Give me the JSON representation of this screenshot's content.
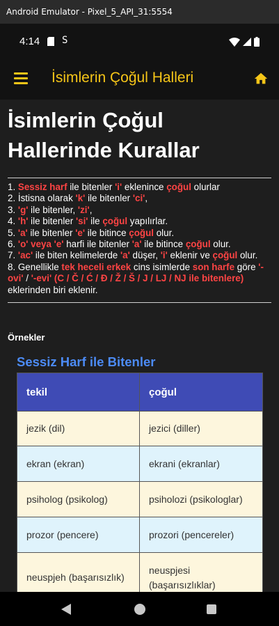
{
  "window": {
    "title": "Android Emulator - Pixel_5_API_31:5554"
  },
  "status": {
    "time": "4:14",
    "s_icon_glyph": "S",
    "icons": [
      "sd-card-icon",
      "sync-icon",
      "wifi-icon",
      "signal-icon",
      "battery-icon"
    ]
  },
  "appbar": {
    "title": "İsimlerin Çoğul Halleri",
    "menu_icon": "menu-icon",
    "home_icon": "home-icon",
    "accent": "#f5c518"
  },
  "page": {
    "title": "İsimlerin Çoğul Hallerinde Kurallar",
    "rules": [
      [
        {
          "t": "1. "
        },
        {
          "t": "Sessiz harf",
          "h": true
        },
        {
          "t": " ile bitenler "
        },
        {
          "t": "'i'",
          "h": true
        },
        {
          "t": " eklenince "
        },
        {
          "t": "çoğul",
          "h": true
        },
        {
          "t": " olurlar"
        }
      ],
      [
        {
          "t": "2. İstisna olarak "
        },
        {
          "t": "'k'",
          "h": true
        },
        {
          "t": " ile bitenler "
        },
        {
          "t": "'ci'",
          "h": true
        },
        {
          "t": ","
        }
      ],
      [
        {
          "t": "3. "
        },
        {
          "t": "'g'",
          "h": true
        },
        {
          "t": " ile bitenler, "
        },
        {
          "t": "'zi'",
          "h": true
        },
        {
          "t": ","
        }
      ],
      [
        {
          "t": "4. "
        },
        {
          "t": "'h'",
          "h": true
        },
        {
          "t": " ile bitenler "
        },
        {
          "t": "'si'",
          "h": true
        },
        {
          "t": " ile "
        },
        {
          "t": "çoğul",
          "h": true
        },
        {
          "t": " yapılırlar."
        }
      ],
      [
        {
          "t": "5. "
        },
        {
          "t": "'a'",
          "h": true
        },
        {
          "t": " ile bitenler "
        },
        {
          "t": "'e'",
          "h": true
        },
        {
          "t": " ile bitince "
        },
        {
          "t": "çoğul",
          "h": true
        },
        {
          "t": " olur."
        }
      ],
      [
        {
          "t": "6. "
        },
        {
          "t": "'o' veya 'e'",
          "h": true
        },
        {
          "t": " harfi ile bitenler "
        },
        {
          "t": "'a'",
          "h": true
        },
        {
          "t": " ile bitince "
        },
        {
          "t": "çoğul",
          "h": true
        },
        {
          "t": " olur."
        }
      ],
      [
        {
          "t": "7. "
        },
        {
          "t": "'ac'",
          "h": true
        },
        {
          "t": " ile biten kelimelerde "
        },
        {
          "t": "'a'",
          "h": true
        },
        {
          "t": " düşer, "
        },
        {
          "t": "'i'",
          "h": true
        },
        {
          "t": " eklenir ve "
        },
        {
          "t": "çoğul",
          "h": true
        },
        {
          "t": " olur."
        }
      ],
      [
        {
          "t": "8. Genellikle "
        },
        {
          "t": "tek heceli erkek",
          "h": true
        },
        {
          "t": " cins isimlerde "
        },
        {
          "t": "son harfe",
          "h": true
        },
        {
          "t": " göre "
        },
        {
          "t": "'-ovi'",
          "h": true
        },
        {
          "t": " / "
        },
        {
          "t": "'-evi' (C / Č / Ć / Đ / Ž / Š / J / LJ / NJ ile bitenlere)",
          "h": true
        },
        {
          "t": " eklerinden biri eklenir."
        }
      ]
    ],
    "examples_label": "Örnekler",
    "section_title": "Sessiz Harf ile Bitenler",
    "table": {
      "headers": [
        "tekil",
        "çoğul"
      ],
      "rows": [
        [
          "jezik (dil)",
          "jezici (diller)"
        ],
        [
          "ekran (ekran)",
          "ekrani (ekranlar)"
        ],
        [
          "psiholog (psikolog)",
          "psiholozi (psikologlar)"
        ],
        [
          "prozor (pencere)",
          "prozori (pencereler)"
        ],
        [
          "neuspjeh (başarısızlık)",
          "neuspjesi (başarısızlıklar)"
        ],
        [
          "",
          ""
        ]
      ]
    }
  },
  "colors": {
    "highlight": "#ff4444",
    "section_title": "#4c8bf5",
    "table_header": "#3f4bb5",
    "row_cream": "#fdf6dd",
    "row_blue": "#dff3fc"
  },
  "navbar": {
    "icons": [
      "back-icon",
      "home-circle-icon",
      "recents-icon"
    ]
  }
}
